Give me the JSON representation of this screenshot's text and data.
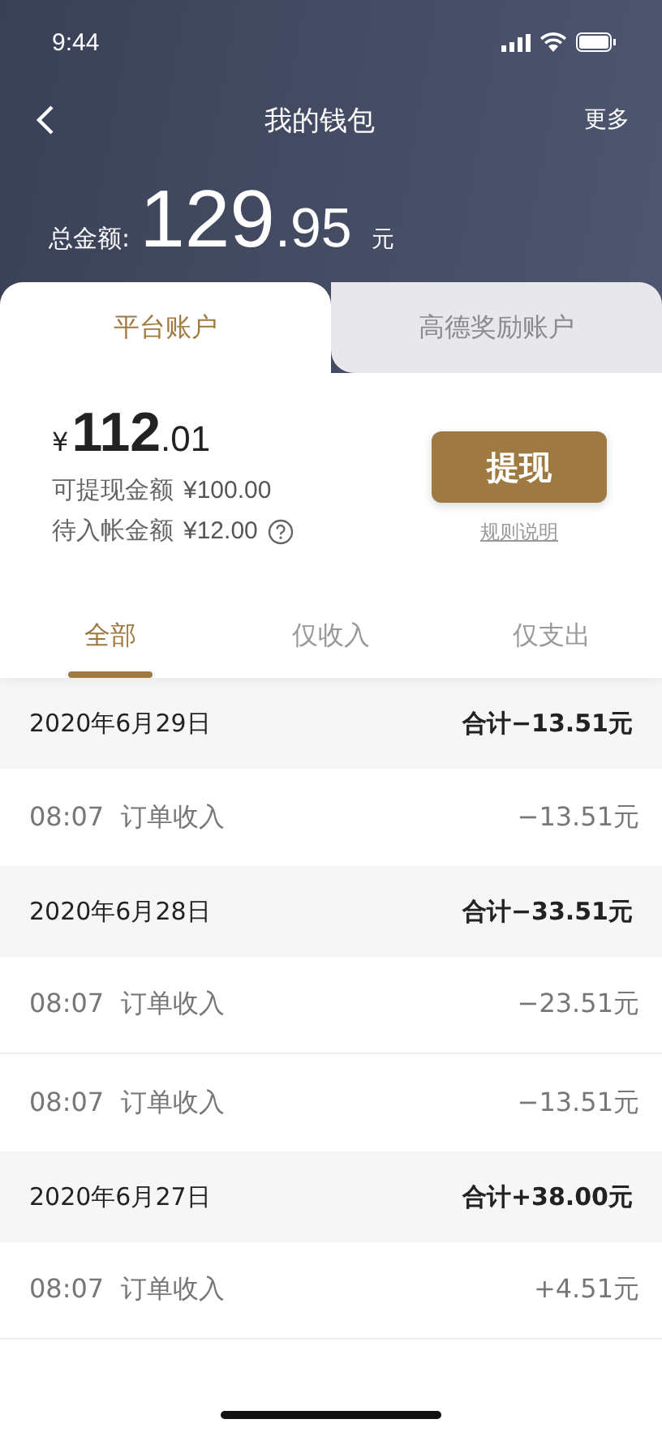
{
  "status_bar": {
    "time": "9:44"
  },
  "nav": {
    "title": "我的钱包",
    "action": "更多"
  },
  "total": {
    "label": "总金额:",
    "whole": "129",
    "decimal": ".95",
    "unit": "元"
  },
  "account_tabs": [
    {
      "label": "平台账户",
      "selected": true
    },
    {
      "label": "高德奖励账户",
      "selected": false
    }
  ],
  "balance": {
    "currency": "¥",
    "whole": "112",
    "decimal": ".01",
    "withdrawable_label": "可提现金额",
    "withdrawable": "¥100.00",
    "pending_label": "待入帐金额",
    "pending": "¥12.00",
    "withdraw_button": "提现",
    "rules_link": "规则说明"
  },
  "filter_tabs": [
    {
      "label": "全部",
      "selected": true
    },
    {
      "label": "仅收入",
      "selected": false
    },
    {
      "label": "仅支出",
      "selected": false
    }
  ],
  "days": [
    {
      "date": "2020年6月29日",
      "total": "合计−13.51元",
      "items": [
        {
          "time": "08:07",
          "title": "订单收入",
          "amount": "−13.51元"
        }
      ]
    },
    {
      "date": "2020年6月28日",
      "total": "合计−33.51元",
      "items": [
        {
          "time": "08:07",
          "title": "订单收入",
          "amount": "−23.51元"
        },
        {
          "time": "08:07",
          "title": "订单收入",
          "amount": "−13.51元"
        }
      ]
    },
    {
      "date": "2020年6月27日",
      "total": "合计+38.00元",
      "items": [
        {
          "time": "08:07",
          "title": "订单收入",
          "amount": "+4.51元"
        }
      ]
    }
  ]
}
